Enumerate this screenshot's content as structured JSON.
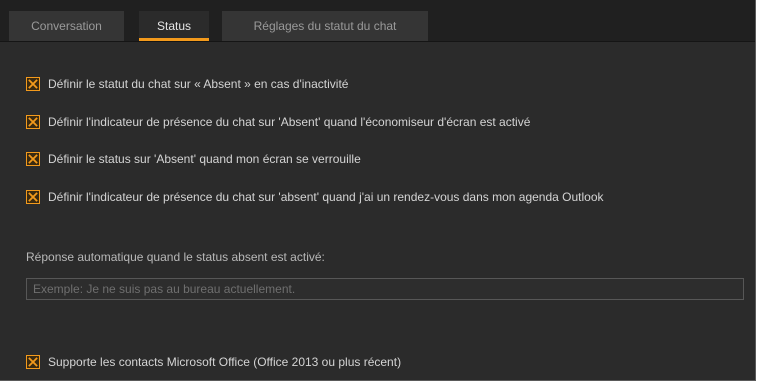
{
  "tabs": [
    {
      "label": "Conversation",
      "active": false
    },
    {
      "label": "Status",
      "active": true
    },
    {
      "label": "Réglages du statut du chat",
      "active": false
    }
  ],
  "options": [
    {
      "label": "Définir le statut du chat sur « Absent » en cas d'inactivité",
      "checked": true
    },
    {
      "label": "Définir l'indicateur de présence du chat sur 'Absent' quand l'économiseur d'écran est activé",
      "checked": true
    },
    {
      "label": "Définir le status sur 'Absent' quand mon écran se verrouille",
      "checked": true
    },
    {
      "label": "Définir l'indicateur de présence du chat sur 'absent' quand j'ai un rendez-vous dans mon agenda Outlook",
      "checked": true
    }
  ],
  "auto_reply": {
    "label": "Réponse automatique quand le status absent est activé:",
    "value": "",
    "placeholder": "Exemple: Je ne suis pas au bureau actuellement."
  },
  "office_option": {
    "label": "Supporte les contacts Microsoft Office (Office 2013 ou plus récent)",
    "checked": true
  },
  "colors": {
    "accent": "#f39a1c",
    "background": "#2b2b2b",
    "tab_bar": "#202020"
  }
}
